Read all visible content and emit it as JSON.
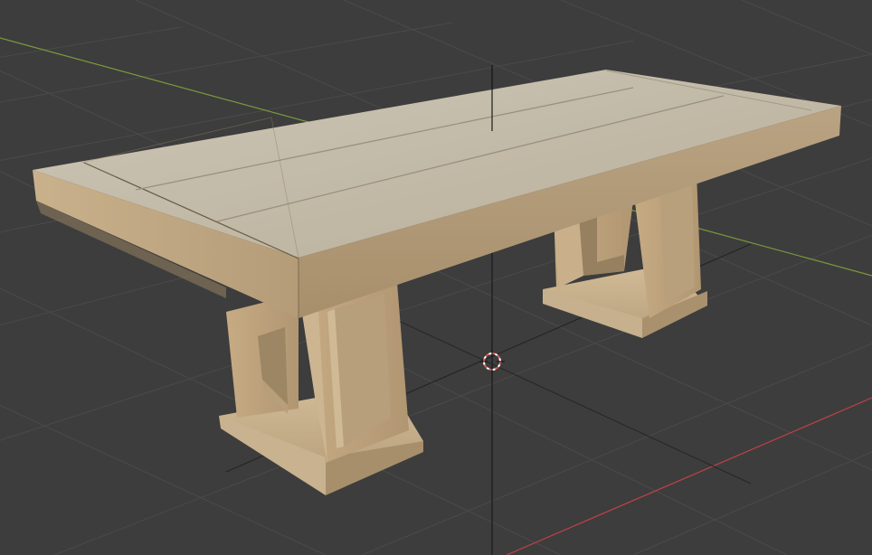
{
  "viewport": {
    "background_color": "#3d3d3d",
    "grid_color": "#4a4a4a",
    "x_axis_color": "#c0404a",
    "y_axis_color": "#7a9a3c",
    "z_axis_color": "#1a1a1a"
  },
  "scene": {
    "object": "wooden-table",
    "wood_top_color": "#c4bba8",
    "wood_side_color": "#b7a487",
    "wood_leg_color": "#c0a784",
    "wood_shadow_color": "#9a8668"
  },
  "cursor_3d": {
    "icon": "3d-cursor-icon",
    "color_a": "#e35a5a",
    "color_b": "#ffffff"
  }
}
